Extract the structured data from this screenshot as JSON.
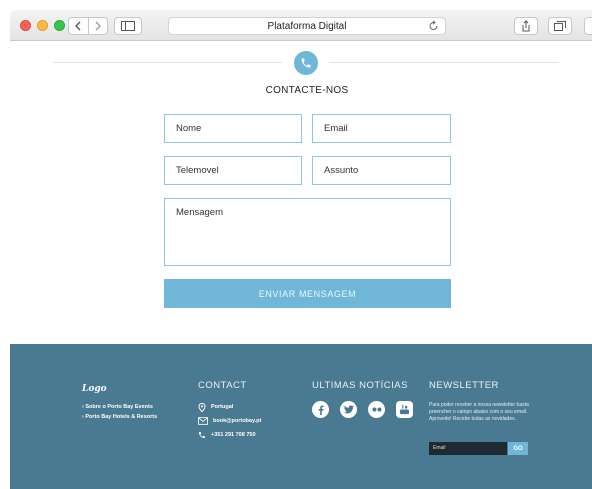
{
  "browser": {
    "address": "Plataforma Digital"
  },
  "contact": {
    "title": "CONTACTE-NOS",
    "fields": {
      "name": "Nome",
      "email": "Email",
      "phone": "Telemovel",
      "subject": "Assunto",
      "message": "Mensagem"
    },
    "send_label": "ENVIAR MENSAGEM"
  },
  "footer": {
    "logo": "Logo",
    "links": [
      "› Sobre o Porto Bay Events",
      "› Porto Bay Hotels & Resorts"
    ],
    "contact_title": "CONTACT",
    "contact_items": {
      "location": "Portugal",
      "email": "book@portobay.pt",
      "phone": "+351 291 708 750"
    },
    "news_title": "ULTIMAS NOTÍCIAS",
    "newsletter_title": "NEWSLETTER",
    "newsletter_text": "Para poder receber a nossa newsletter basta preencher o campo abaixo com o seu email. Aproveite! Recebe todas as novidades.",
    "newsletter_placeholder": "Email",
    "newsletter_button": "GO"
  },
  "colors": {
    "accent": "#6fb6d9",
    "footer_bg": "#4a7a91",
    "field_border": "#8fc7e2"
  }
}
